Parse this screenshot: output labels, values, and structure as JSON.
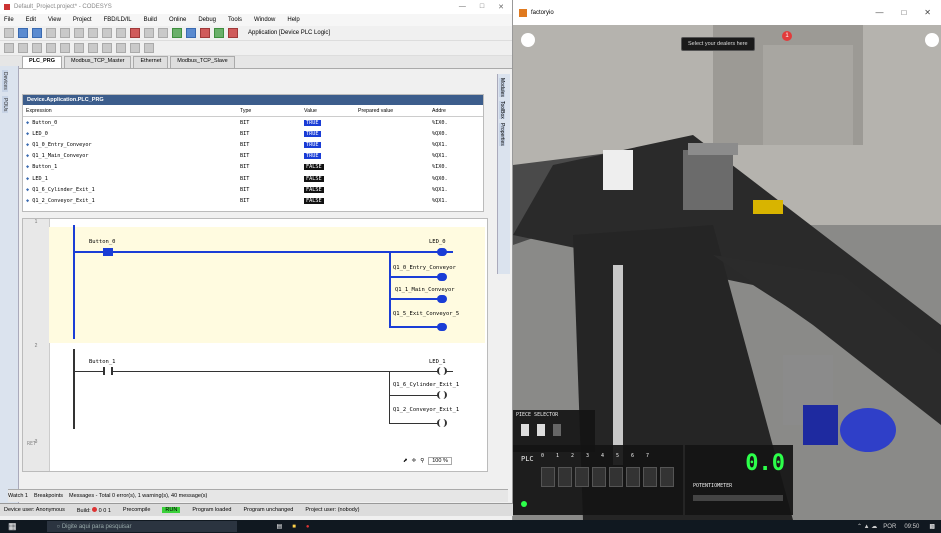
{
  "ide": {
    "title": "Default_Project.project* - CODESYS",
    "menu": [
      "File",
      "Edit",
      "View",
      "Project",
      "FBD/LD/IL",
      "Build",
      "Online",
      "Debug",
      "Tools",
      "Window",
      "Help"
    ],
    "application_label": "Application [Device PLC Logic]",
    "tabs": [
      "PLC_PRG",
      "Modbus_TCP_Master",
      "Ethernet",
      "Modbus_TCP_Slave"
    ],
    "side_labels": [
      "Devices",
      "POUs"
    ],
    "right_side_labels": [
      "Modules",
      "ToolBox",
      "Properties"
    ],
    "watch": {
      "header": "Device.Application.PLC_PRG",
      "columns": [
        "Expression",
        "Type",
        "Value",
        "Prepared value",
        "Addre"
      ],
      "rows": [
        {
          "expr": "Button_0",
          "type": "BIT",
          "value": "TRUE",
          "addr": "%IX0."
        },
        {
          "expr": "LED_0",
          "type": "BIT",
          "value": "TRUE",
          "addr": "%QX0."
        },
        {
          "expr": "Q1_0_Entry_Conveyor",
          "type": "BIT",
          "value": "TRUE",
          "addr": "%QX1."
        },
        {
          "expr": "Q1_1_Main_Conveyor",
          "type": "BIT",
          "value": "TRUE",
          "addr": "%QX1."
        },
        {
          "expr": "Button_1",
          "type": "BIT",
          "value": "FALSE",
          "addr": "%IX0."
        },
        {
          "expr": "LED_1",
          "type": "BIT",
          "value": "FALSE",
          "addr": "%QX0."
        },
        {
          "expr": "Q1_6_Cylinder_Exit_1",
          "type": "BIT",
          "value": "FALSE",
          "addr": "%QX1."
        },
        {
          "expr": "Q1_2_Conveyor_Exit_1",
          "type": "BIT",
          "value": "FALSE",
          "addr": "%QX1."
        }
      ]
    },
    "ladder": {
      "rung1": {
        "contact": "Button_0",
        "coils": [
          "LED_0",
          "Q1_0_Entry_Conveyor",
          "Q1_1_Main_Conveyor",
          "Q1_5_Exit_Conveyor_5"
        ]
      },
      "rung2": {
        "contact": "Button_1",
        "coils": [
          "LED_1",
          "Q1_6_Cylinder_Exit_1",
          "Q1_2_Conveyor_Exit_1"
        ]
      },
      "rung_numbers": [
        "1",
        "2",
        "3"
      ],
      "rung3_label": "RET"
    },
    "zoom": "100 %",
    "message_tabs": [
      "Watch 1",
      "Breakpoints",
      "Messages - Total 0 error(s), 1 warning(s), 40 message(s)"
    ],
    "status": {
      "device_user": "Device user: Anonymous",
      "build": "Build:",
      "build_counts": "0 0 1",
      "precompile": "Precompile",
      "run": "RUN",
      "program_loaded": "Program loaded",
      "program_unchanged": "Program unchanged",
      "project_user": "Project user: (nobody)"
    }
  },
  "factory": {
    "title": "factoryio",
    "tooltip": "Select your dealers here",
    "badge": "1",
    "piece_selector": "PIECE SELECTOR",
    "plc_label": "PLC",
    "digit_labels": [
      "0",
      "1",
      "2",
      "3",
      "4",
      "5",
      "6",
      "7"
    ],
    "counter_value": "0.0",
    "counter_label": "POTENTIOMETER"
  },
  "taskbar": {
    "search_placeholder": "Digite aqui para pesquisar",
    "lang": "POR",
    "time": "09:50"
  }
}
